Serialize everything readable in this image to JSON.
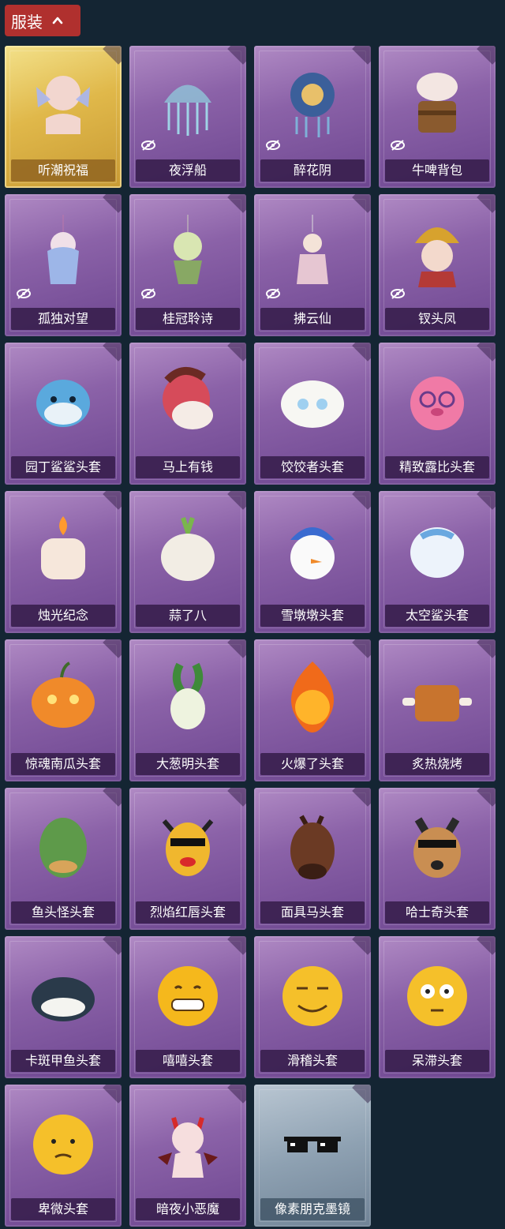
{
  "section": {
    "title": "服装",
    "toggle_icon": "chevron-up-icon",
    "accent": "#b0302e"
  },
  "items": [
    {
      "name": "听潮祝福",
      "style": "gold",
      "hidden": false,
      "icon": "ocean-doll-icon"
    },
    {
      "name": "夜浮船",
      "style": "purple",
      "hidden": true,
      "icon": "jellyfish-icon"
    },
    {
      "name": "醉花阴",
      "style": "purple",
      "hidden": true,
      "icon": "flower-ornament-icon"
    },
    {
      "name": "牛啤背包",
      "style": "purple",
      "hidden": true,
      "icon": "beer-cow-icon"
    },
    {
      "name": "孤独对望",
      "style": "purple",
      "hidden": true,
      "icon": "doll-charm-icon"
    },
    {
      "name": "桂冠聆诗",
      "style": "purple",
      "hidden": true,
      "icon": "laurel-charm-icon"
    },
    {
      "name": "拂云仙",
      "style": "purple",
      "hidden": true,
      "icon": "fairy-charm-icon"
    },
    {
      "name": "钗头凤",
      "style": "purple",
      "hidden": true,
      "icon": "phoenix-crown-icon"
    },
    {
      "name": "园丁鲨鲨头套",
      "style": "purple",
      "hidden": false,
      "icon": "shark-head-icon"
    },
    {
      "name": "马上有钱",
      "style": "purple",
      "hidden": false,
      "icon": "horse-head-icon"
    },
    {
      "name": "饺饺者头套",
      "style": "purple",
      "hidden": false,
      "icon": "dumpling-head-icon"
    },
    {
      "name": "精致露比头套",
      "style": "purple",
      "hidden": false,
      "icon": "pink-pig-head-icon"
    },
    {
      "name": "烛光纪念",
      "style": "purple",
      "hidden": false,
      "icon": "candle-head-icon"
    },
    {
      "name": "蒜了八",
      "style": "purple",
      "hidden": false,
      "icon": "garlic-head-icon"
    },
    {
      "name": "雪墩墩头套",
      "style": "purple",
      "hidden": false,
      "icon": "snowman-head-icon"
    },
    {
      "name": "太空鲨头套",
      "style": "purple",
      "hidden": false,
      "icon": "space-shark-head-icon"
    },
    {
      "name": "惊魂南瓜头套",
      "style": "purple",
      "hidden": false,
      "icon": "pumpkin-head-icon"
    },
    {
      "name": "大葱明头套",
      "style": "purple",
      "hidden": false,
      "icon": "scallion-head-icon"
    },
    {
      "name": "火爆了头套",
      "style": "purple",
      "hidden": false,
      "icon": "fire-head-icon"
    },
    {
      "name": "炙热烧烤",
      "style": "purple",
      "hidden": false,
      "icon": "bbq-head-icon"
    },
    {
      "name": "鱼头怪头套",
      "style": "purple",
      "hidden": false,
      "icon": "fish-head-icon"
    },
    {
      "name": "烈焰红唇头套",
      "style": "purple",
      "hidden": false,
      "icon": "red-lips-head-icon"
    },
    {
      "name": "面具马头套",
      "style": "purple",
      "hidden": false,
      "icon": "horse-mask-icon"
    },
    {
      "name": "哈士奇头套",
      "style": "purple",
      "hidden": false,
      "icon": "husky-head-icon"
    },
    {
      "name": "卡斑甲鱼头套",
      "style": "purple",
      "hidden": false,
      "icon": "turtle-head-icon"
    },
    {
      "name": "嘻嘻头套",
      "style": "purple",
      "hidden": false,
      "icon": "grin-emoji-icon"
    },
    {
      "name": "滑稽头套",
      "style": "purple",
      "hidden": false,
      "icon": "funny-emoji-icon"
    },
    {
      "name": "呆滞头套",
      "style": "purple",
      "hidden": false,
      "icon": "dazed-emoji-icon"
    },
    {
      "name": "卑微头套",
      "style": "purple",
      "hidden": false,
      "icon": "humble-emoji-icon"
    },
    {
      "name": "暗夜小恶魔",
      "style": "purple",
      "hidden": false,
      "icon": "little-devil-icon"
    },
    {
      "name": "像素朋克墨镜",
      "style": "grey",
      "hidden": false,
      "icon": "pixel-sunglasses-icon"
    }
  ]
}
